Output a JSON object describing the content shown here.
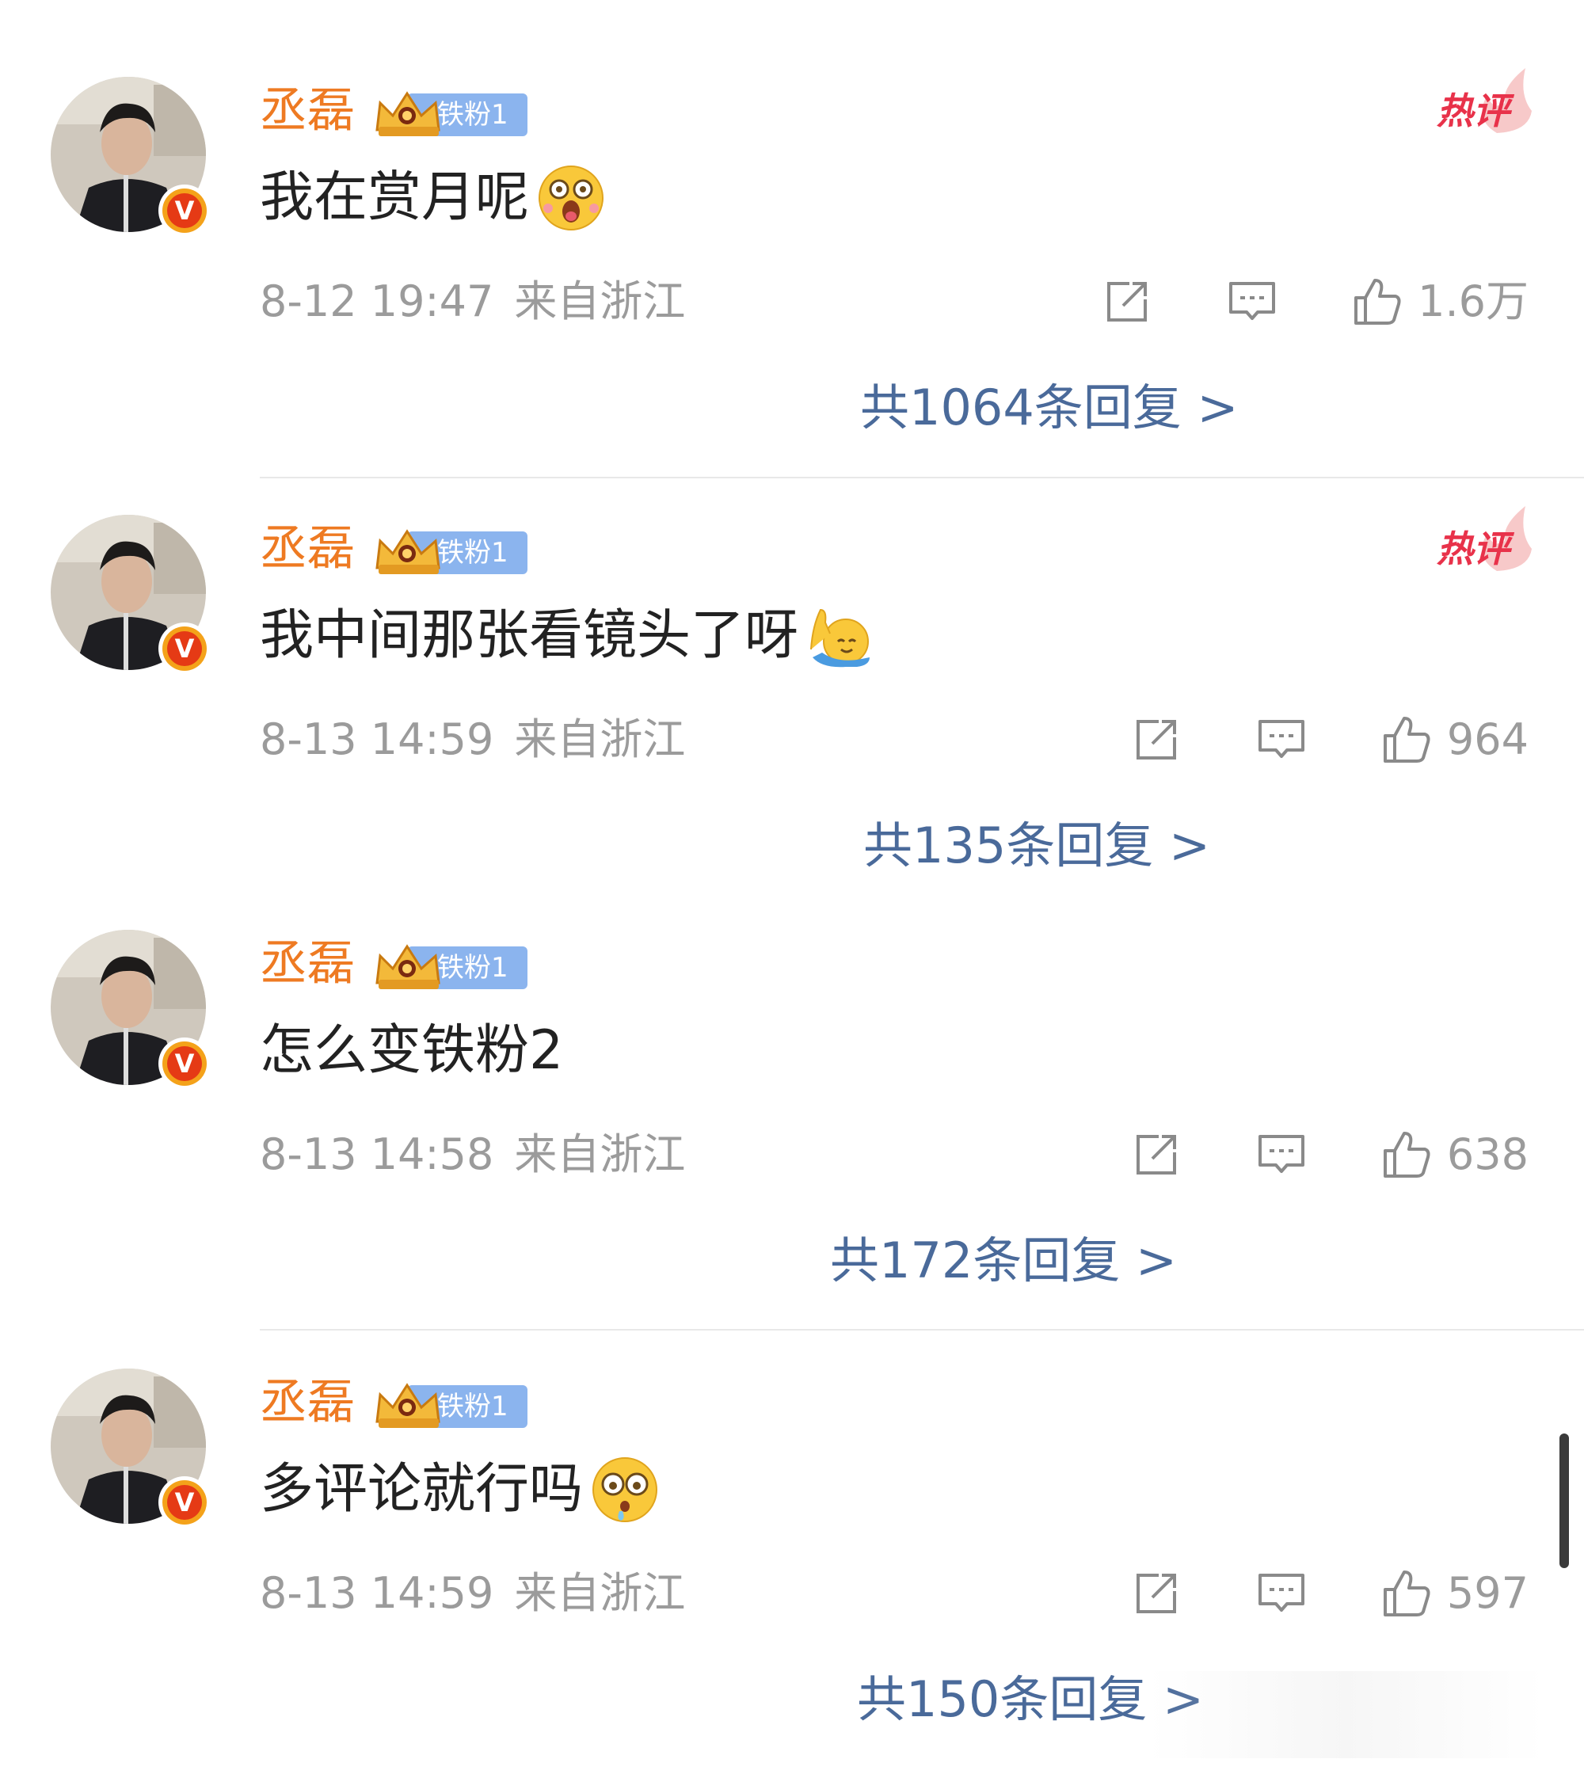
{
  "comments": [
    {
      "username": "丞磊",
      "fan_badge": "铁粉1",
      "hot_tag": "热评",
      "text": "我在赏月呢",
      "emoji": "star-struck-emoji",
      "time": "8-12 19:47",
      "location": "来自浙江",
      "likes": "1.6万",
      "replies": "共1064条回复 >"
    },
    {
      "username": "丞磊",
      "fan_badge": "铁粉1",
      "hot_tag": "热评",
      "text": "我中间那张看镜头了呀",
      "emoji": "hand-raised-emoji",
      "time": "8-13 14:59",
      "location": "来自浙江",
      "likes": "964",
      "replies": "共135条回复 >"
    },
    {
      "username": "丞磊",
      "fan_badge": "铁粉1",
      "hot_tag": "",
      "text": "怎么变铁粉2",
      "emoji": "",
      "time": "8-13 14:58",
      "location": "来自浙江",
      "likes": "638",
      "replies": "共172条回复 >"
    },
    {
      "username": "丞磊",
      "fan_badge": "铁粉1",
      "hot_tag": "",
      "text": "多评论就行吗",
      "emoji": "pleading-tears-emoji",
      "time": "8-13 14:59",
      "location": "来自浙江",
      "likes": "597",
      "replies": "共150条回复 >"
    }
  ],
  "colors": {
    "username": "#ee7a22",
    "replies_link": "#4a6a9a",
    "meta_text": "#9b9b9b",
    "hot_tag": "#e8324a",
    "fan_badge_bg": "#8bb4ee",
    "verified_badge": "#f4a21a"
  }
}
